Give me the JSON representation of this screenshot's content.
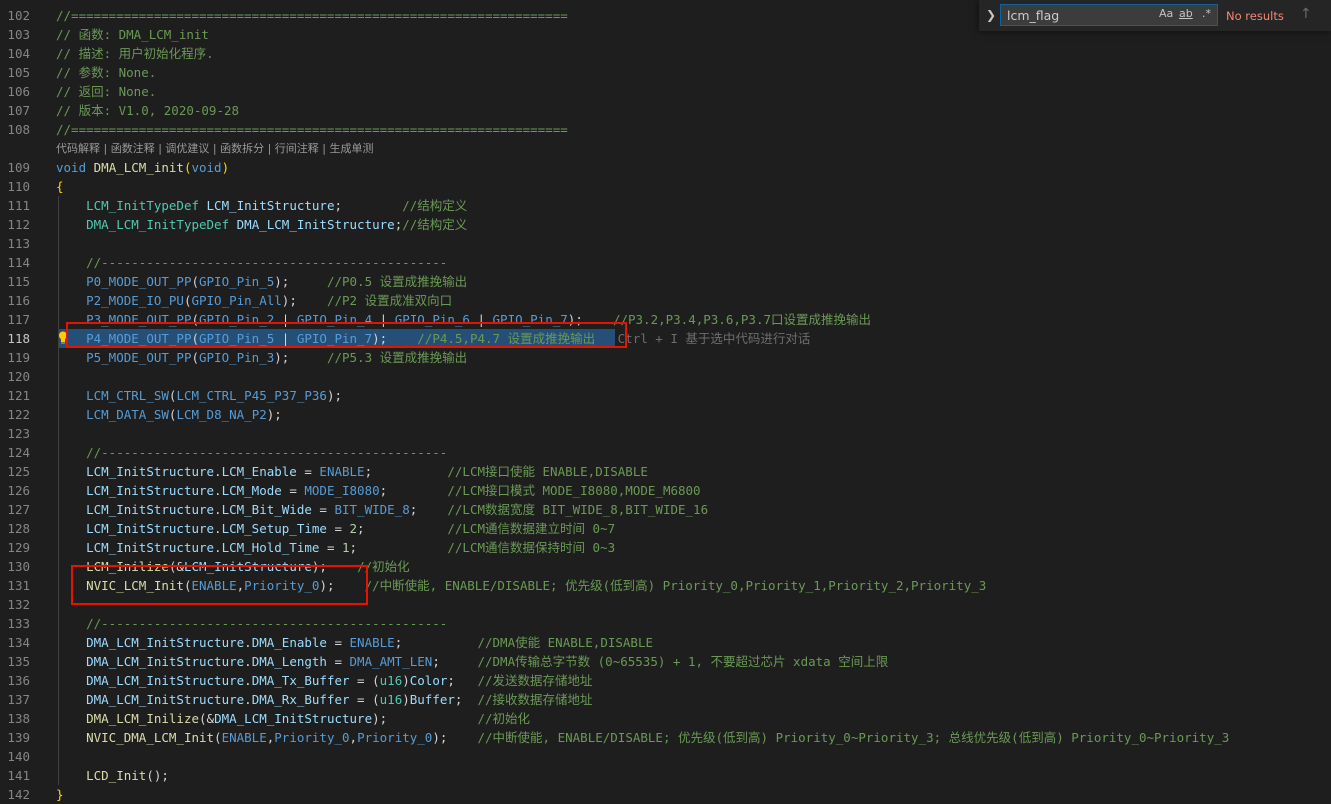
{
  "find": {
    "toggle_icon": "chevron-right-icon",
    "query": "lcm_flag",
    "match_case": "Aa",
    "whole_word": "ab",
    "regex": ".*",
    "results": "No results",
    "prev_icon": "arrow-up-icon"
  },
  "codelens": "代码解释 | 函数注释 | 调优建议 | 函数拆分 | 行间注释 | 生成单测",
  "inline_hint": "Ctrl + I 基于选中代码进行对话",
  "colors": {
    "comment": "#6a9955",
    "keyword": "#569cd6",
    "type": "#4ec9b0",
    "function": "#dcdcaa",
    "macro": "#569cd6",
    "param": "#9cdcfe",
    "number": "#b5cea8",
    "punct": "#d4d4d4",
    "bracket": "#ffd700",
    "selection": "#264f78",
    "redbox": "#e51400",
    "no_results": "#f48771"
  },
  "lines": [
    {
      "n": "102",
      "tokens": [
        {
          "t": "//==================================================================",
          "c": "comment"
        }
      ]
    },
    {
      "n": "103",
      "tokens": [
        {
          "t": "// 函数: DMA_LCM_init",
          "c": "comment"
        }
      ]
    },
    {
      "n": "104",
      "tokens": [
        {
          "t": "// 描述: 用户初始化程序.",
          "c": "comment"
        }
      ]
    },
    {
      "n": "105",
      "tokens": [
        {
          "t": "// 参数: None.",
          "c": "comment"
        }
      ]
    },
    {
      "n": "106",
      "tokens": [
        {
          "t": "// 返回: None.",
          "c": "comment"
        }
      ]
    },
    {
      "n": "107",
      "tokens": [
        {
          "t": "// 版本: V1.0, 2020-09-28",
          "c": "comment"
        }
      ]
    },
    {
      "n": "108",
      "tokens": [
        {
          "t": "//==================================================================",
          "c": "comment"
        }
      ]
    },
    {
      "n": "109",
      "tokens": [
        {
          "t": "void",
          "c": "keyword"
        },
        {
          "t": " ",
          "c": "punct"
        },
        {
          "t": "DMA_LCM_init",
          "c": "function"
        },
        {
          "t": "(",
          "c": "bracket"
        },
        {
          "t": "void",
          "c": "keyword"
        },
        {
          "t": ")",
          "c": "bracket"
        }
      ]
    },
    {
      "n": "110",
      "tokens": [
        {
          "t": "{",
          "c": "bracket"
        }
      ]
    },
    {
      "n": "111",
      "tokens": [
        {
          "t": "    ",
          "c": "punct"
        },
        {
          "t": "LCM_InitTypeDef",
          "c": "type"
        },
        {
          "t": " ",
          "c": "punct"
        },
        {
          "t": "LCM_InitStructure",
          "c": "param"
        },
        {
          "t": ";        ",
          "c": "punct"
        },
        {
          "t": "//结构定义",
          "c": "comment"
        }
      ]
    },
    {
      "n": "112",
      "tokens": [
        {
          "t": "    ",
          "c": "punct"
        },
        {
          "t": "DMA_LCM_InitTypeDef",
          "c": "type"
        },
        {
          "t": " ",
          "c": "punct"
        },
        {
          "t": "DMA_LCM_InitStructure",
          "c": "param"
        },
        {
          "t": ";",
          "c": "punct"
        },
        {
          "t": "//结构定义",
          "c": "comment"
        }
      ]
    },
    {
      "n": "113",
      "tokens": []
    },
    {
      "n": "114",
      "tokens": [
        {
          "t": "    //----------------------------------------------",
          "c": "comment"
        }
      ]
    },
    {
      "n": "115",
      "tokens": [
        {
          "t": "    ",
          "c": "punct"
        },
        {
          "t": "P0_MODE_OUT_PP",
          "c": "macro"
        },
        {
          "t": "(",
          "c": "punct"
        },
        {
          "t": "GPIO_Pin_5",
          "c": "macro"
        },
        {
          "t": ");     ",
          "c": "punct"
        },
        {
          "t": "//P0.5 设置成推挽输出",
          "c": "comment"
        }
      ]
    },
    {
      "n": "116",
      "tokens": [
        {
          "t": "    ",
          "c": "punct"
        },
        {
          "t": "P2_MODE_IO_PU",
          "c": "macro"
        },
        {
          "t": "(",
          "c": "punct"
        },
        {
          "t": "GPIO_Pin_All",
          "c": "macro"
        },
        {
          "t": ");    ",
          "c": "punct"
        },
        {
          "t": "//P2 设置成准双向口",
          "c": "comment"
        }
      ]
    },
    {
      "n": "117",
      "tokens": [
        {
          "t": "    ",
          "c": "punct"
        },
        {
          "t": "P3_MODE_OUT_PP",
          "c": "macro"
        },
        {
          "t": "(",
          "c": "punct"
        },
        {
          "t": "GPIO_Pin_2",
          "c": "macro"
        },
        {
          "t": " | ",
          "c": "punct"
        },
        {
          "t": "GPIO_Pin_4",
          "c": "macro"
        },
        {
          "t": " | ",
          "c": "punct"
        },
        {
          "t": "GPIO_Pin_6",
          "c": "macro"
        },
        {
          "t": " | ",
          "c": "punct"
        },
        {
          "t": "GPIO_Pin_7",
          "c": "macro"
        },
        {
          "t": ");    ",
          "c": "punct"
        },
        {
          "t": "//P3.2,P3.4,P3.6,P3.7口设置成推挽输出",
          "c": "comment"
        }
      ]
    },
    {
      "n": "118",
      "tokens": [
        {
          "t": "    ",
          "c": "punct"
        },
        {
          "t": "P4_MODE_OUT_PP",
          "c": "macro"
        },
        {
          "t": "(",
          "c": "punct"
        },
        {
          "t": "GPIO_Pin_5",
          "c": "macro"
        },
        {
          "t": " | ",
          "c": "punct"
        },
        {
          "t": "GPIO_Pin_7",
          "c": "macro"
        },
        {
          "t": ");    ",
          "c": "punct"
        },
        {
          "t": "//P4.5,P4.7 设置成推挽输出",
          "c": "comment"
        }
      ]
    },
    {
      "n": "119",
      "tokens": [
        {
          "t": "    ",
          "c": "punct"
        },
        {
          "t": "P5_MODE_OUT_PP",
          "c": "macro"
        },
        {
          "t": "(",
          "c": "punct"
        },
        {
          "t": "GPIO_Pin_3",
          "c": "macro"
        },
        {
          "t": ");     ",
          "c": "punct"
        },
        {
          "t": "//P5.3 设置成推挽输出",
          "c": "comment"
        }
      ]
    },
    {
      "n": "120",
      "tokens": []
    },
    {
      "n": "121",
      "tokens": [
        {
          "t": "    ",
          "c": "punct"
        },
        {
          "t": "LCM_CTRL_SW",
          "c": "macro"
        },
        {
          "t": "(",
          "c": "punct"
        },
        {
          "t": "LCM_CTRL_P45_P37_P36",
          "c": "macro"
        },
        {
          "t": ");",
          "c": "punct"
        }
      ]
    },
    {
      "n": "122",
      "tokens": [
        {
          "t": "    ",
          "c": "punct"
        },
        {
          "t": "LCM_DATA_SW",
          "c": "macro"
        },
        {
          "t": "(",
          "c": "punct"
        },
        {
          "t": "LCM_D8_NA_P2",
          "c": "macro"
        },
        {
          "t": ");",
          "c": "punct"
        }
      ]
    },
    {
      "n": "123",
      "tokens": []
    },
    {
      "n": "124",
      "tokens": [
        {
          "t": "    //----------------------------------------------",
          "c": "comment"
        }
      ]
    },
    {
      "n": "125",
      "tokens": [
        {
          "t": "    ",
          "c": "punct"
        },
        {
          "t": "LCM_InitStructure",
          "c": "param"
        },
        {
          "t": ".",
          "c": "punct"
        },
        {
          "t": "LCM_Enable",
          "c": "param"
        },
        {
          "t": " = ",
          "c": "punct"
        },
        {
          "t": "ENABLE",
          "c": "macro"
        },
        {
          "t": ";          ",
          "c": "punct"
        },
        {
          "t": "//LCM接口使能 ENABLE,DISABLE",
          "c": "comment"
        }
      ]
    },
    {
      "n": "126",
      "tokens": [
        {
          "t": "    ",
          "c": "punct"
        },
        {
          "t": "LCM_InitStructure",
          "c": "param"
        },
        {
          "t": ".",
          "c": "punct"
        },
        {
          "t": "LCM_Mode",
          "c": "param"
        },
        {
          "t": " = ",
          "c": "punct"
        },
        {
          "t": "MODE_I8080",
          "c": "macro"
        },
        {
          "t": ";        ",
          "c": "punct"
        },
        {
          "t": "//LCM接口模式 MODE_I8080,MODE_M6800",
          "c": "comment"
        }
      ]
    },
    {
      "n": "127",
      "tokens": [
        {
          "t": "    ",
          "c": "punct"
        },
        {
          "t": "LCM_InitStructure",
          "c": "param"
        },
        {
          "t": ".",
          "c": "punct"
        },
        {
          "t": "LCM_Bit_Wide",
          "c": "param"
        },
        {
          "t": " = ",
          "c": "punct"
        },
        {
          "t": "BIT_WIDE_8",
          "c": "macro"
        },
        {
          "t": ";    ",
          "c": "punct"
        },
        {
          "t": "//LCM数据宽度 BIT_WIDE_8,BIT_WIDE_16",
          "c": "comment"
        }
      ]
    },
    {
      "n": "128",
      "tokens": [
        {
          "t": "    ",
          "c": "punct"
        },
        {
          "t": "LCM_InitStructure",
          "c": "param"
        },
        {
          "t": ".",
          "c": "punct"
        },
        {
          "t": "LCM_Setup_Time",
          "c": "param"
        },
        {
          "t": " = ",
          "c": "punct"
        },
        {
          "t": "2",
          "c": "number"
        },
        {
          "t": ";           ",
          "c": "punct"
        },
        {
          "t": "//LCM通信数据建立时间 0~7",
          "c": "comment"
        }
      ]
    },
    {
      "n": "129",
      "tokens": [
        {
          "t": "    ",
          "c": "punct"
        },
        {
          "t": "LCM_InitStructure",
          "c": "param"
        },
        {
          "t": ".",
          "c": "punct"
        },
        {
          "t": "LCM_Hold_Time",
          "c": "param"
        },
        {
          "t": " = ",
          "c": "punct"
        },
        {
          "t": "1",
          "c": "number"
        },
        {
          "t": ";            ",
          "c": "punct"
        },
        {
          "t": "//LCM通信数据保持时间 0~3",
          "c": "comment"
        }
      ]
    },
    {
      "n": "130",
      "tokens": [
        {
          "t": "    ",
          "c": "punct"
        },
        {
          "t": "LCM_Inilize",
          "c": "function"
        },
        {
          "t": "(&",
          "c": "punct"
        },
        {
          "t": "LCM_InitStructure",
          "c": "param"
        },
        {
          "t": ");    ",
          "c": "punct"
        },
        {
          "t": "//初始化",
          "c": "comment"
        }
      ]
    },
    {
      "n": "131",
      "tokens": [
        {
          "t": "    ",
          "c": "punct"
        },
        {
          "t": "NVIC_LCM_Init",
          "c": "function"
        },
        {
          "t": "(",
          "c": "punct"
        },
        {
          "t": "ENABLE",
          "c": "macro"
        },
        {
          "t": ",",
          "c": "punct"
        },
        {
          "t": "Priority_0",
          "c": "macro"
        },
        {
          "t": ");    ",
          "c": "punct"
        },
        {
          "t": "//中断使能, ENABLE/DISABLE; 优先级(低到高) Priority_0,Priority_1,Priority_2,Priority_3",
          "c": "comment"
        }
      ]
    },
    {
      "n": "132",
      "tokens": []
    },
    {
      "n": "133",
      "tokens": [
        {
          "t": "    //----------------------------------------------",
          "c": "comment"
        }
      ]
    },
    {
      "n": "134",
      "tokens": [
        {
          "t": "    ",
          "c": "punct"
        },
        {
          "t": "DMA_LCM_InitStructure",
          "c": "param"
        },
        {
          "t": ".",
          "c": "punct"
        },
        {
          "t": "DMA_Enable",
          "c": "param"
        },
        {
          "t": " = ",
          "c": "punct"
        },
        {
          "t": "ENABLE",
          "c": "macro"
        },
        {
          "t": ";          ",
          "c": "punct"
        },
        {
          "t": "//DMA使能 ENABLE,DISABLE",
          "c": "comment"
        }
      ]
    },
    {
      "n": "135",
      "tokens": [
        {
          "t": "    ",
          "c": "punct"
        },
        {
          "t": "DMA_LCM_InitStructure",
          "c": "param"
        },
        {
          "t": ".",
          "c": "punct"
        },
        {
          "t": "DMA_Length",
          "c": "param"
        },
        {
          "t": " = ",
          "c": "punct"
        },
        {
          "t": "DMA_AMT_LEN",
          "c": "macro"
        },
        {
          "t": ";     ",
          "c": "punct"
        },
        {
          "t": "//DMA传输总字节数 (0~65535) + 1, 不要超过芯片 xdata 空间上限",
          "c": "comment"
        }
      ]
    },
    {
      "n": "136",
      "tokens": [
        {
          "t": "    ",
          "c": "punct"
        },
        {
          "t": "DMA_LCM_InitStructure",
          "c": "param"
        },
        {
          "t": ".",
          "c": "punct"
        },
        {
          "t": "DMA_Tx_Buffer",
          "c": "param"
        },
        {
          "t": " = (",
          "c": "punct"
        },
        {
          "t": "u16",
          "c": "type"
        },
        {
          "t": ")",
          "c": "punct"
        },
        {
          "t": "Color",
          "c": "param"
        },
        {
          "t": ";   ",
          "c": "punct"
        },
        {
          "t": "//发送数据存储地址",
          "c": "comment"
        }
      ]
    },
    {
      "n": "137",
      "tokens": [
        {
          "t": "    ",
          "c": "punct"
        },
        {
          "t": "DMA_LCM_InitStructure",
          "c": "param"
        },
        {
          "t": ".",
          "c": "punct"
        },
        {
          "t": "DMA_Rx_Buffer",
          "c": "param"
        },
        {
          "t": " = (",
          "c": "punct"
        },
        {
          "t": "u16",
          "c": "type"
        },
        {
          "t": ")",
          "c": "punct"
        },
        {
          "t": "Buffer",
          "c": "param"
        },
        {
          "t": ";  ",
          "c": "punct"
        },
        {
          "t": "//接收数据存储地址",
          "c": "comment"
        }
      ]
    },
    {
      "n": "138",
      "tokens": [
        {
          "t": "    ",
          "c": "punct"
        },
        {
          "t": "DMA_LCM_Inilize",
          "c": "function"
        },
        {
          "t": "(&",
          "c": "punct"
        },
        {
          "t": "DMA_LCM_InitStructure",
          "c": "param"
        },
        {
          "t": ");            ",
          "c": "punct"
        },
        {
          "t": "//初始化",
          "c": "comment"
        }
      ]
    },
    {
      "n": "139",
      "tokens": [
        {
          "t": "    ",
          "c": "punct"
        },
        {
          "t": "NVIC_DMA_LCM_Init",
          "c": "function"
        },
        {
          "t": "(",
          "c": "punct"
        },
        {
          "t": "ENABLE",
          "c": "macro"
        },
        {
          "t": ",",
          "c": "punct"
        },
        {
          "t": "Priority_0",
          "c": "macro"
        },
        {
          "t": ",",
          "c": "punct"
        },
        {
          "t": "Priority_0",
          "c": "macro"
        },
        {
          "t": ");    ",
          "c": "punct"
        },
        {
          "t": "//中断使能, ENABLE/DISABLE; 优先级(低到高) Priority_0~Priority_3; 总线优先级(低到高) Priority_0~Priority_3",
          "c": "comment"
        }
      ]
    },
    {
      "n": "140",
      "tokens": []
    },
    {
      "n": "141",
      "tokens": [
        {
          "t": "    ",
          "c": "punct"
        },
        {
          "t": "LCD_Init",
          "c": "function"
        },
        {
          "t": "();",
          "c": "punct"
        }
      ]
    },
    {
      "n": "142",
      "tokens": [
        {
          "t": "}",
          "c": "bracket"
        }
      ]
    }
  ]
}
